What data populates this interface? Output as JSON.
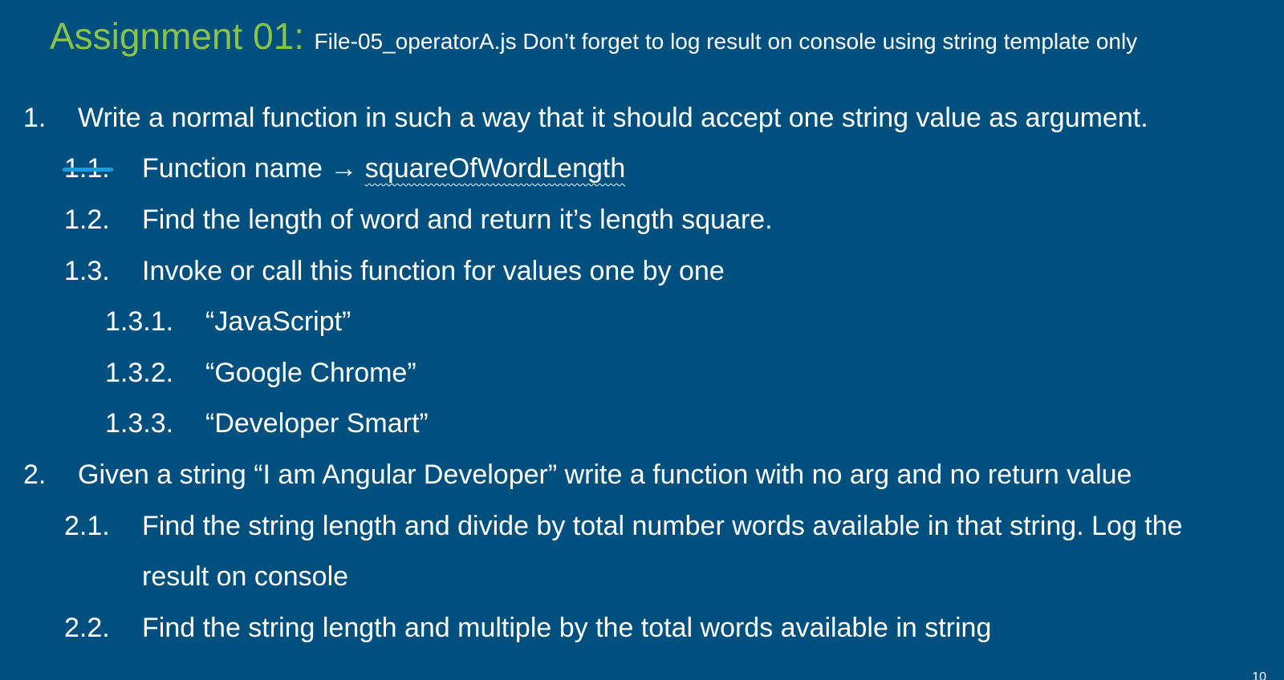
{
  "title": {
    "main": "Assignment 01:",
    "sub": "File-05_operatorA.js Don’t forget to log result on console using string template only"
  },
  "items": [
    {
      "num": "1.",
      "text": "Write a normal function in such a way that it should accept one string value as argument."
    },
    {
      "num": "1.1.",
      "text_before": "Function name → ",
      "text_code": "squareOfWordLength"
    },
    {
      "num": "1.2.",
      "text": "Find the length of word and return it’s length square."
    },
    {
      "num": "1.3.",
      "text": "Invoke or call this function for values one by one"
    },
    {
      "num": "1.3.1.",
      "text": "“JavaScript”"
    },
    {
      "num": "1.3.2.",
      "text": "“Google Chrome”"
    },
    {
      "num": "1.3.3.",
      "text": "“Developer Smart”"
    },
    {
      "num": "2.",
      "text": "Given a string “I am Angular Developer” write a function with no arg and no return value"
    },
    {
      "num": "2.1.",
      "text": "Find the string length and divide by total number words available in that string. Log the"
    },
    {
      "num": "",
      "text": "result on console"
    },
    {
      "num": "2.2.",
      "text": "Find the string length and multiple by the total words available in string"
    }
  ],
  "page_number": "10",
  "colors": {
    "background": "#00507f",
    "title_accent": "#8bc34a",
    "strike_mark": "#1a9be0"
  }
}
